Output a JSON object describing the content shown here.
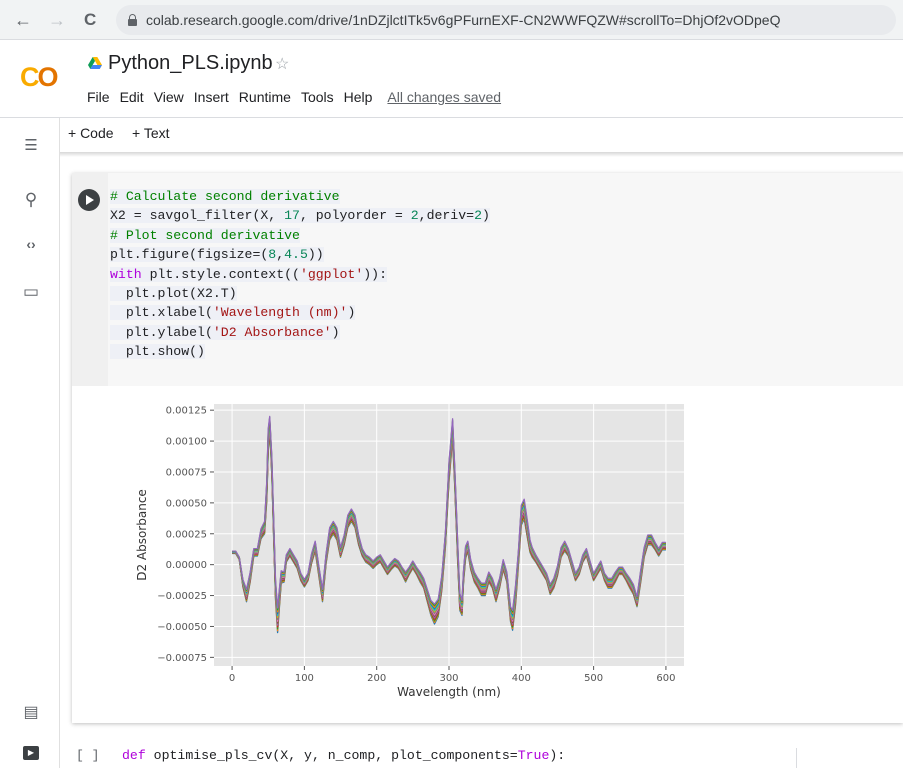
{
  "browser": {
    "back_glyph": "←",
    "forward_glyph": "→",
    "reload_glyph": "C",
    "url": "colab.research.google.com/drive/1nDZjlctITk5v6gPFurnEXF-CN2WWFQZW#scrollTo=DhjOf2vODpeQ"
  },
  "header": {
    "logo": {
      "c": "C",
      "o": "O"
    },
    "notebook_title": "Python_PLS.ipynb",
    "star_glyph": "☆",
    "menu": [
      "File",
      "Edit",
      "View",
      "Insert",
      "Runtime",
      "Tools",
      "Help"
    ],
    "save_status": "All changes saved"
  },
  "toolbar": {
    "add_code": "+ Code",
    "add_text": "+ Text"
  },
  "left_rail": {
    "icons": [
      "table-of-contents-icon",
      "search-icon",
      "code-snippets-icon",
      "files-icon",
      "terminal-output-icon",
      "terminal-icon"
    ],
    "glyphs": {
      "toc": "☰",
      "search": "⚲",
      "code": "‹›",
      "files": "▭",
      "scratch": "▤",
      "terminal": "▶"
    }
  },
  "cell": {
    "lines": [
      [
        {
          "t": "# Calculate second derivative",
          "c": "c-comment"
        }
      ],
      [
        {
          "t": "X2 = savgol_filter(X, ",
          "c": "c-plain"
        },
        {
          "t": "17",
          "c": "c-num"
        },
        {
          "t": ", polyorder = ",
          "c": "c-plain"
        },
        {
          "t": "2",
          "c": "c-num"
        },
        {
          "t": ",deriv=",
          "c": "c-plain"
        },
        {
          "t": "2",
          "c": "c-num"
        },
        {
          "t": ")",
          "c": "c-plain"
        }
      ],
      [
        {
          "t": "# Plot second derivative",
          "c": "c-comment"
        }
      ],
      [
        {
          "t": "plt.figure(figsize=(",
          "c": "c-plain"
        },
        {
          "t": "8",
          "c": "c-num"
        },
        {
          "t": ",",
          "c": "c-plain"
        },
        {
          "t": "4.5",
          "c": "c-num"
        },
        {
          "t": "))",
          "c": "c-plain"
        }
      ],
      [
        {
          "t": "with",
          "c": "c-kw"
        },
        {
          "t": " plt.style.context((",
          "c": "c-plain"
        },
        {
          "t": "'ggplot'",
          "c": "c-str"
        },
        {
          "t": ")):",
          "c": "c-plain"
        }
      ],
      [
        {
          "t": "  plt.plot(X2.T)",
          "c": "c-plain"
        }
      ],
      [
        {
          "t": "  plt.xlabel(",
          "c": "c-plain"
        },
        {
          "t": "'Wavelength (nm)'",
          "c": "c-str"
        },
        {
          "t": ")",
          "c": "c-plain"
        }
      ],
      [
        {
          "t": "  plt.ylabel(",
          "c": "c-plain"
        },
        {
          "t": "'D2 Absorbance'",
          "c": "c-str"
        },
        {
          "t": ")",
          "c": "c-plain"
        }
      ],
      [
        {
          "t": "  plt.show()",
          "c": "c-plain"
        }
      ]
    ]
  },
  "next_cell": {
    "bracket": "[ ]",
    "code": [
      {
        "t": "def",
        "c": "c-kw"
      },
      {
        "t": " optimise_pls_cv(X, y, n_comp, plot_components=",
        "c": "c-plain"
      },
      {
        "t": "True",
        "c": "c-kw"
      },
      {
        "t": "):",
        "c": "c-plain"
      }
    ]
  },
  "chart_data": {
    "type": "line",
    "style": "ggplot",
    "xlabel": "Wavelength (nm)",
    "ylabel": "D2 Absorbance",
    "xlim": [
      -25,
      625
    ],
    "ylim": [
      -0.00082,
      0.0013
    ],
    "xticks": [
      0,
      100,
      200,
      300,
      400,
      500,
      600
    ],
    "xtick_labels": [
      "0",
      "100",
      "200",
      "300",
      "400",
      "500",
      "600"
    ],
    "yticks": [
      -0.00075,
      -0.0005,
      -0.00025,
      0.0,
      0.00025,
      0.0005,
      0.00075,
      0.001,
      0.00125
    ],
    "ytick_labels": [
      "−0.00075",
      "−0.00050",
      "−0.00025",
      "0.00000",
      "0.00025",
      "0.00050",
      "0.00075",
      "0.00100",
      "0.00125"
    ],
    "grid": true,
    "series_count": 14,
    "series_colors": [
      "#1f77b4",
      "#ff7f0e",
      "#2ca02c",
      "#d62728",
      "#9467bd",
      "#8c564b",
      "#e377c2",
      "#7f7f7f",
      "#bcbd22",
      "#17becf",
      "#1f77b4",
      "#ff7f0e",
      "#2ca02c",
      "#9467bd"
    ],
    "envelope": {
      "x": [
        0,
        5,
        10,
        15,
        20,
        25,
        30,
        35,
        40,
        45,
        48,
        50,
        52,
        55,
        58,
        60,
        63,
        65,
        68,
        72,
        75,
        80,
        85,
        90,
        95,
        100,
        105,
        110,
        115,
        120,
        125,
        130,
        135,
        140,
        145,
        150,
        155,
        160,
        165,
        170,
        175,
        180,
        185,
        190,
        195,
        200,
        205,
        210,
        215,
        220,
        225,
        230,
        235,
        240,
        245,
        250,
        255,
        260,
        265,
        270,
        275,
        280,
        285,
        290,
        295,
        300,
        305,
        308,
        312,
        315,
        318,
        320,
        323,
        326,
        330,
        335,
        340,
        345,
        350,
        355,
        360,
        365,
        370,
        375,
        380,
        385,
        388,
        392,
        396,
        400,
        404,
        408,
        412,
        415,
        420,
        425,
        430,
        435,
        440,
        445,
        450,
        455,
        460,
        465,
        470,
        475,
        480,
        485,
        490,
        495,
        500,
        505,
        510,
        515,
        520,
        525,
        530,
        535,
        540,
        545,
        550,
        555,
        560,
        565,
        570,
        575,
        580,
        585,
        590,
        595,
        600
      ],
      "y": [
        0.0001,
        0.0001,
        5e-05,
        -0.00015,
        -0.00025,
        -0.0001,
        0.0001,
        0.0001,
        0.00025,
        0.0003,
        0.0006,
        0.001,
        0.00115,
        0.0008,
        0.0002,
        -0.0002,
        -0.00045,
        -0.0003,
        -0.0001,
        -0.0001,
        5e-05,
        0.0001,
        5e-05,
        0.0,
        -0.0001,
        -0.00015,
        -0.0001,
        5e-05,
        0.00015,
        -5e-05,
        -0.00025,
        5e-05,
        0.00025,
        0.0003,
        0.00025,
        0.0001,
        0.0002,
        0.00035,
        0.0004,
        0.00035,
        0.0002,
        0.0001,
        5e-05,
        3e-05,
        0.0,
        3e-05,
        5e-05,
        0.0,
        -5e-05,
        -1e-05,
        2e-05,
        0.0,
        -5e-05,
        -0.0001,
        -5e-05,
        0.0,
        -5e-05,
        -0.0001,
        -0.00015,
        -0.00025,
        -0.00035,
        -0.0004,
        -0.00035,
        -0.00015,
        0.0002,
        0.00075,
        0.0011,
        0.0007,
        0.0001,
        -0.0003,
        -0.00035,
        -0.0001,
        0.0001,
        0.00015,
        0.0,
        -0.0001,
        -0.00015,
        -0.0002,
        -0.0002,
        -0.0001,
        -0.00015,
        -0.00025,
        -0.00015,
        0.0,
        -0.0001,
        -0.0004,
        -0.00045,
        -0.00025,
        5e-05,
        0.0004,
        0.00045,
        0.0003,
        0.00015,
        0.0001,
        5e-05,
        0.0,
        -5e-05,
        -0.0001,
        -0.0002,
        -0.00015,
        -5e-05,
        0.0001,
        0.00015,
        0.0001,
        0.0,
        -0.0001,
        -5e-05,
        5e-05,
        0.0001,
        0.0,
        -0.0001,
        -5e-05,
        0.0,
        -0.0001,
        -0.00015,
        -0.00015,
        -0.0001,
        -5e-05,
        -5e-05,
        -0.0001,
        -0.00015,
        -0.0002,
        -0.0003,
        -0.0001,
        0.0001,
        0.0002,
        0.0002,
        0.00015,
        0.0001,
        0.00015,
        0.00015
      ],
      "amp": [
        1e-05,
        1e-05,
        1e-05,
        3e-05,
        5e-05,
        4e-05,
        3e-05,
        3e-05,
        4e-05,
        5e-05,
        8e-05,
        0.0001,
        5e-05,
        8e-05,
        8e-05,
        8e-05,
        0.0001,
        8e-05,
        5e-05,
        4e-05,
        3e-05,
        3e-05,
        3e-05,
        3e-05,
        3e-05,
        3e-05,
        3e-05,
        4e-05,
        4e-05,
        4e-05,
        5e-05,
        4e-05,
        5e-05,
        5e-05,
        5e-05,
        4e-05,
        4e-05,
        5e-05,
        5e-05,
        5e-05,
        4e-05,
        3e-05,
        3e-05,
        3e-05,
        3e-05,
        3e-05,
        3e-05,
        3e-05,
        3e-05,
        3e-05,
        3e-05,
        3e-05,
        3e-05,
        4e-05,
        3e-05,
        3e-05,
        3e-05,
        4e-05,
        4e-05,
        5e-05,
        6e-05,
        8e-05,
        7e-05,
        6e-05,
        6e-05,
        8e-05,
        8e-05,
        8e-05,
        8e-05,
        7e-05,
        6e-05,
        5e-05,
        5e-05,
        4e-05,
        4e-05,
        4e-05,
        4e-05,
        5e-05,
        5e-05,
        4e-05,
        4e-05,
        5e-05,
        4e-05,
        4e-05,
        4e-05,
        6e-05,
        8e-05,
        8e-05,
        6e-05,
        8e-05,
        8e-05,
        7e-05,
        5e-05,
        4e-05,
        3e-05,
        3e-05,
        3e-05,
        3e-05,
        4e-05,
        4e-05,
        4e-05,
        4e-05,
        4e-05,
        3e-05,
        3e-05,
        3e-05,
        3e-05,
        3e-05,
        3e-05,
        3e-05,
        3e-05,
        3e-05,
        3e-05,
        3e-05,
        4e-05,
        4e-05,
        4e-05,
        3e-05,
        3e-05,
        3e-05,
        4e-05,
        4e-05,
        4e-05,
        5e-05,
        4e-05,
        4e-05,
        4e-05,
        3e-05,
        3e-05,
        3e-05,
        3e-05
      ]
    }
  }
}
